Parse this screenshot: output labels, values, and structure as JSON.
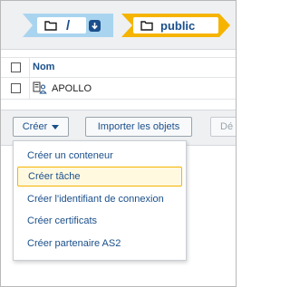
{
  "breadcrumb": {
    "root_label": "/",
    "current_label": "public",
    "colors": {
      "root_bg": "#a9d4ef",
      "current_bg": "#f5b400",
      "text": "#1a4f8b"
    }
  },
  "table": {
    "header": {
      "name": "Nom"
    },
    "rows": [
      {
        "name": "APOLLO",
        "icon": "server-user-icon"
      }
    ]
  },
  "toolbar": {
    "create_label": "Créer",
    "import_label": "Importer les objets",
    "disabled_label": "Dé"
  },
  "create_menu": {
    "items": [
      {
        "label": "Créer un conteneur"
      },
      {
        "label": "Créer tâche",
        "active": true
      },
      {
        "label": "Créer l'identifiant de connexion"
      },
      {
        "label": "Créer certificats"
      },
      {
        "label": "Créer partenaire AS2"
      }
    ]
  }
}
